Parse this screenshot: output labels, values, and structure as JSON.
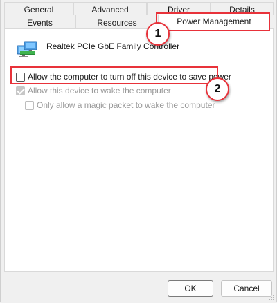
{
  "tabs": {
    "row1": [
      "General",
      "Advanced",
      "Driver",
      "Details"
    ],
    "row2": [
      "Events",
      "Resources",
      "Power Management"
    ],
    "active": "Power Management"
  },
  "device": {
    "name": "Realtek PCIe GbE Family Controller",
    "icon": "network-adapter-icon"
  },
  "options": {
    "allow_off": {
      "label": "Allow the computer to turn off this device to save power",
      "checked": false,
      "enabled": true
    },
    "allow_wake": {
      "label": "Allow this device to wake the computer",
      "checked": true,
      "enabled": false
    },
    "magic_packet": {
      "label": "Only allow a magic packet to wake the computer",
      "checked": false,
      "enabled": false
    }
  },
  "annotations": {
    "badge1": "1",
    "badge2": "2",
    "highlight_color": "#e8323a"
  },
  "buttons": {
    "ok": "OK",
    "cancel": "Cancel"
  }
}
